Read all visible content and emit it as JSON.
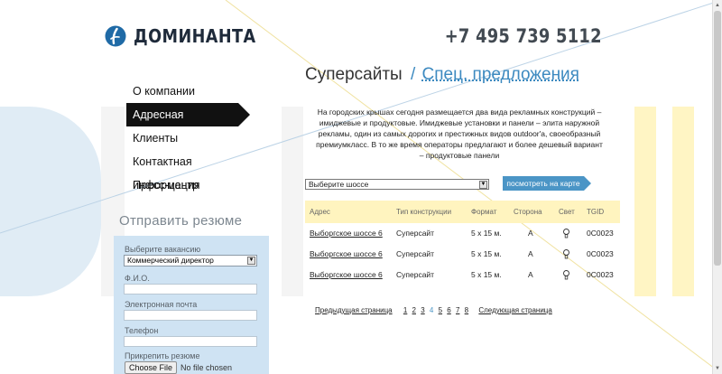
{
  "header": {
    "brand": "ДОМИНАНТА",
    "phone": "+7 495 739 5112"
  },
  "nav": {
    "items": [
      {
        "label": "О компании"
      },
      {
        "label": "Адресная программа"
      },
      {
        "label": "Клиенты"
      },
      {
        "label": "Контактная информация"
      },
      {
        "label": "Пресс-центр"
      }
    ]
  },
  "resume": {
    "title": "Отправить резюме",
    "vacancy_label": "Выберите вакансию",
    "vacancy_value": "Коммерческий директор",
    "name_label": "Ф.И.О.",
    "email_label": "Электронная почта",
    "phone_label": "Телефон",
    "attach_label": "Прикрепить резюме",
    "file_button": "Choose File",
    "file_none": "No file chosen"
  },
  "main": {
    "title": "Суперсайты",
    "separator": "/",
    "title_link": "Спец. предложения",
    "description": "На городских крышах сегодня размещается два вида рекламных конструкций – имиджевые и продуктовые. Имиджевые установки и панели – элита наружной рекламы, один из самых дорогих и престижных видов outdoor'a, своеобразный премиумкласс. В то же время операторы предлагают и более дешевый вариант – продуктовые панели"
  },
  "filter": {
    "shosse_value": "Выберите шоссе",
    "map_button": "посмотреть на карте"
  },
  "table": {
    "headers": [
      "Адрес",
      "Тип конструкции",
      "Формат",
      "Сторона",
      "Свет",
      "TGID"
    ],
    "rows": [
      {
        "address": "Выборгское шоссе 6",
        "type": "Суперсайт",
        "format": "5 х 15 м.",
        "side": "А",
        "tgid": "0С0023"
      },
      {
        "address": "Выборгское шоссе 6",
        "type": "Суперсайт",
        "format": "5 х 15 м.",
        "side": "А",
        "tgid": "0С0023"
      },
      {
        "address": "Выборгское шоссе 6",
        "type": "Суперсайт",
        "format": "5 х 15 м.",
        "side": "А",
        "tgid": "0С0023"
      }
    ]
  },
  "pager": {
    "prev": "Предыдущая страница",
    "pages": [
      "1",
      "2",
      "3",
      "4",
      "5",
      "6",
      "7",
      "8"
    ],
    "current": "4",
    "next": "Следующая страница"
  },
  "colors": {
    "accent": "#4b95c6",
    "nav_active": "#111111",
    "table_header": "#fff4bf",
    "resume_bg": "#cfe3f3"
  }
}
